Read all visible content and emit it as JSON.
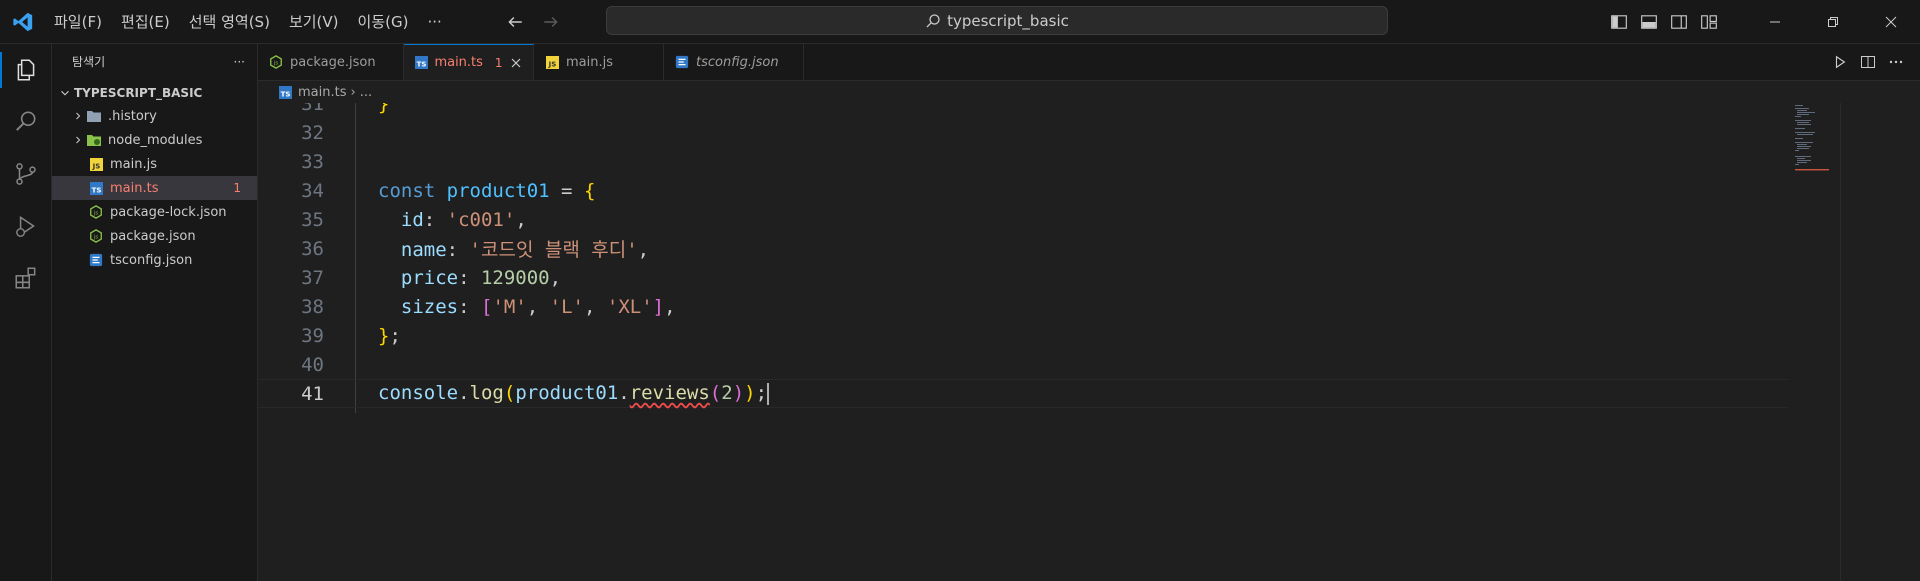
{
  "menu": [
    "파일(F)",
    "편집(E)",
    "선택 영역(S)",
    "보기(V)",
    "이동(G)",
    "···"
  ],
  "search": {
    "text": "typescript_basic"
  },
  "sidebar": {
    "title": "탐색기",
    "more": "···",
    "folder": "TYPESCRIPT_BASIC",
    "items": [
      {
        "label": ".history",
        "type": "folder",
        "icon": "folder-icon"
      },
      {
        "label": "node_modules",
        "type": "folder",
        "icon": "node-folder-icon"
      },
      {
        "label": "main.js",
        "type": "file",
        "icon": "js-file-icon"
      },
      {
        "label": "main.ts",
        "type": "file",
        "icon": "ts-file-icon",
        "badge": "1",
        "selected": true
      },
      {
        "label": "package-lock.json",
        "type": "file",
        "icon": "node-json-icon"
      },
      {
        "label": "package.json",
        "type": "file",
        "icon": "node-json-icon"
      },
      {
        "label": "tsconfig.json",
        "type": "file",
        "icon": "tsconfig-file-icon"
      }
    ]
  },
  "tabs": [
    {
      "label": "package.json",
      "icon": "node-json-icon"
    },
    {
      "label": "main.ts",
      "icon": "ts-file-icon",
      "badge": "1",
      "active": true
    },
    {
      "label": "main.js",
      "icon": "js-file-icon"
    },
    {
      "label": "tsconfig.json",
      "icon": "tsconfig-file-icon",
      "italic": true
    }
  ],
  "breadcrumb": {
    "file": "main.ts",
    "sep": "›",
    "rest": "..."
  },
  "editor": {
    "lines": [
      {
        "num": "31",
        "text": "}"
      },
      {
        "num": "32",
        "text": ""
      },
      {
        "num": "33",
        "text": ""
      },
      {
        "num": "34",
        "text": "const product01 = {"
      },
      {
        "num": "35",
        "text": "  id: 'c001',"
      },
      {
        "num": "36",
        "text": "  name: '코드잇 블랙 후디',"
      },
      {
        "num": "37",
        "text": "  price: 129000,"
      },
      {
        "num": "38",
        "text": "  sizes: ['M', 'L', 'XL'],"
      },
      {
        "num": "39",
        "text": "};"
      },
      {
        "num": "40",
        "text": ""
      },
      {
        "num": "41",
        "text": "console.log(product01.reviews(2));"
      }
    ],
    "current_line": "41"
  },
  "colors": {
    "accent": "#0078d4",
    "error": "#f88070",
    "bg": "#1f1f1f",
    "chrome": "#181818"
  }
}
